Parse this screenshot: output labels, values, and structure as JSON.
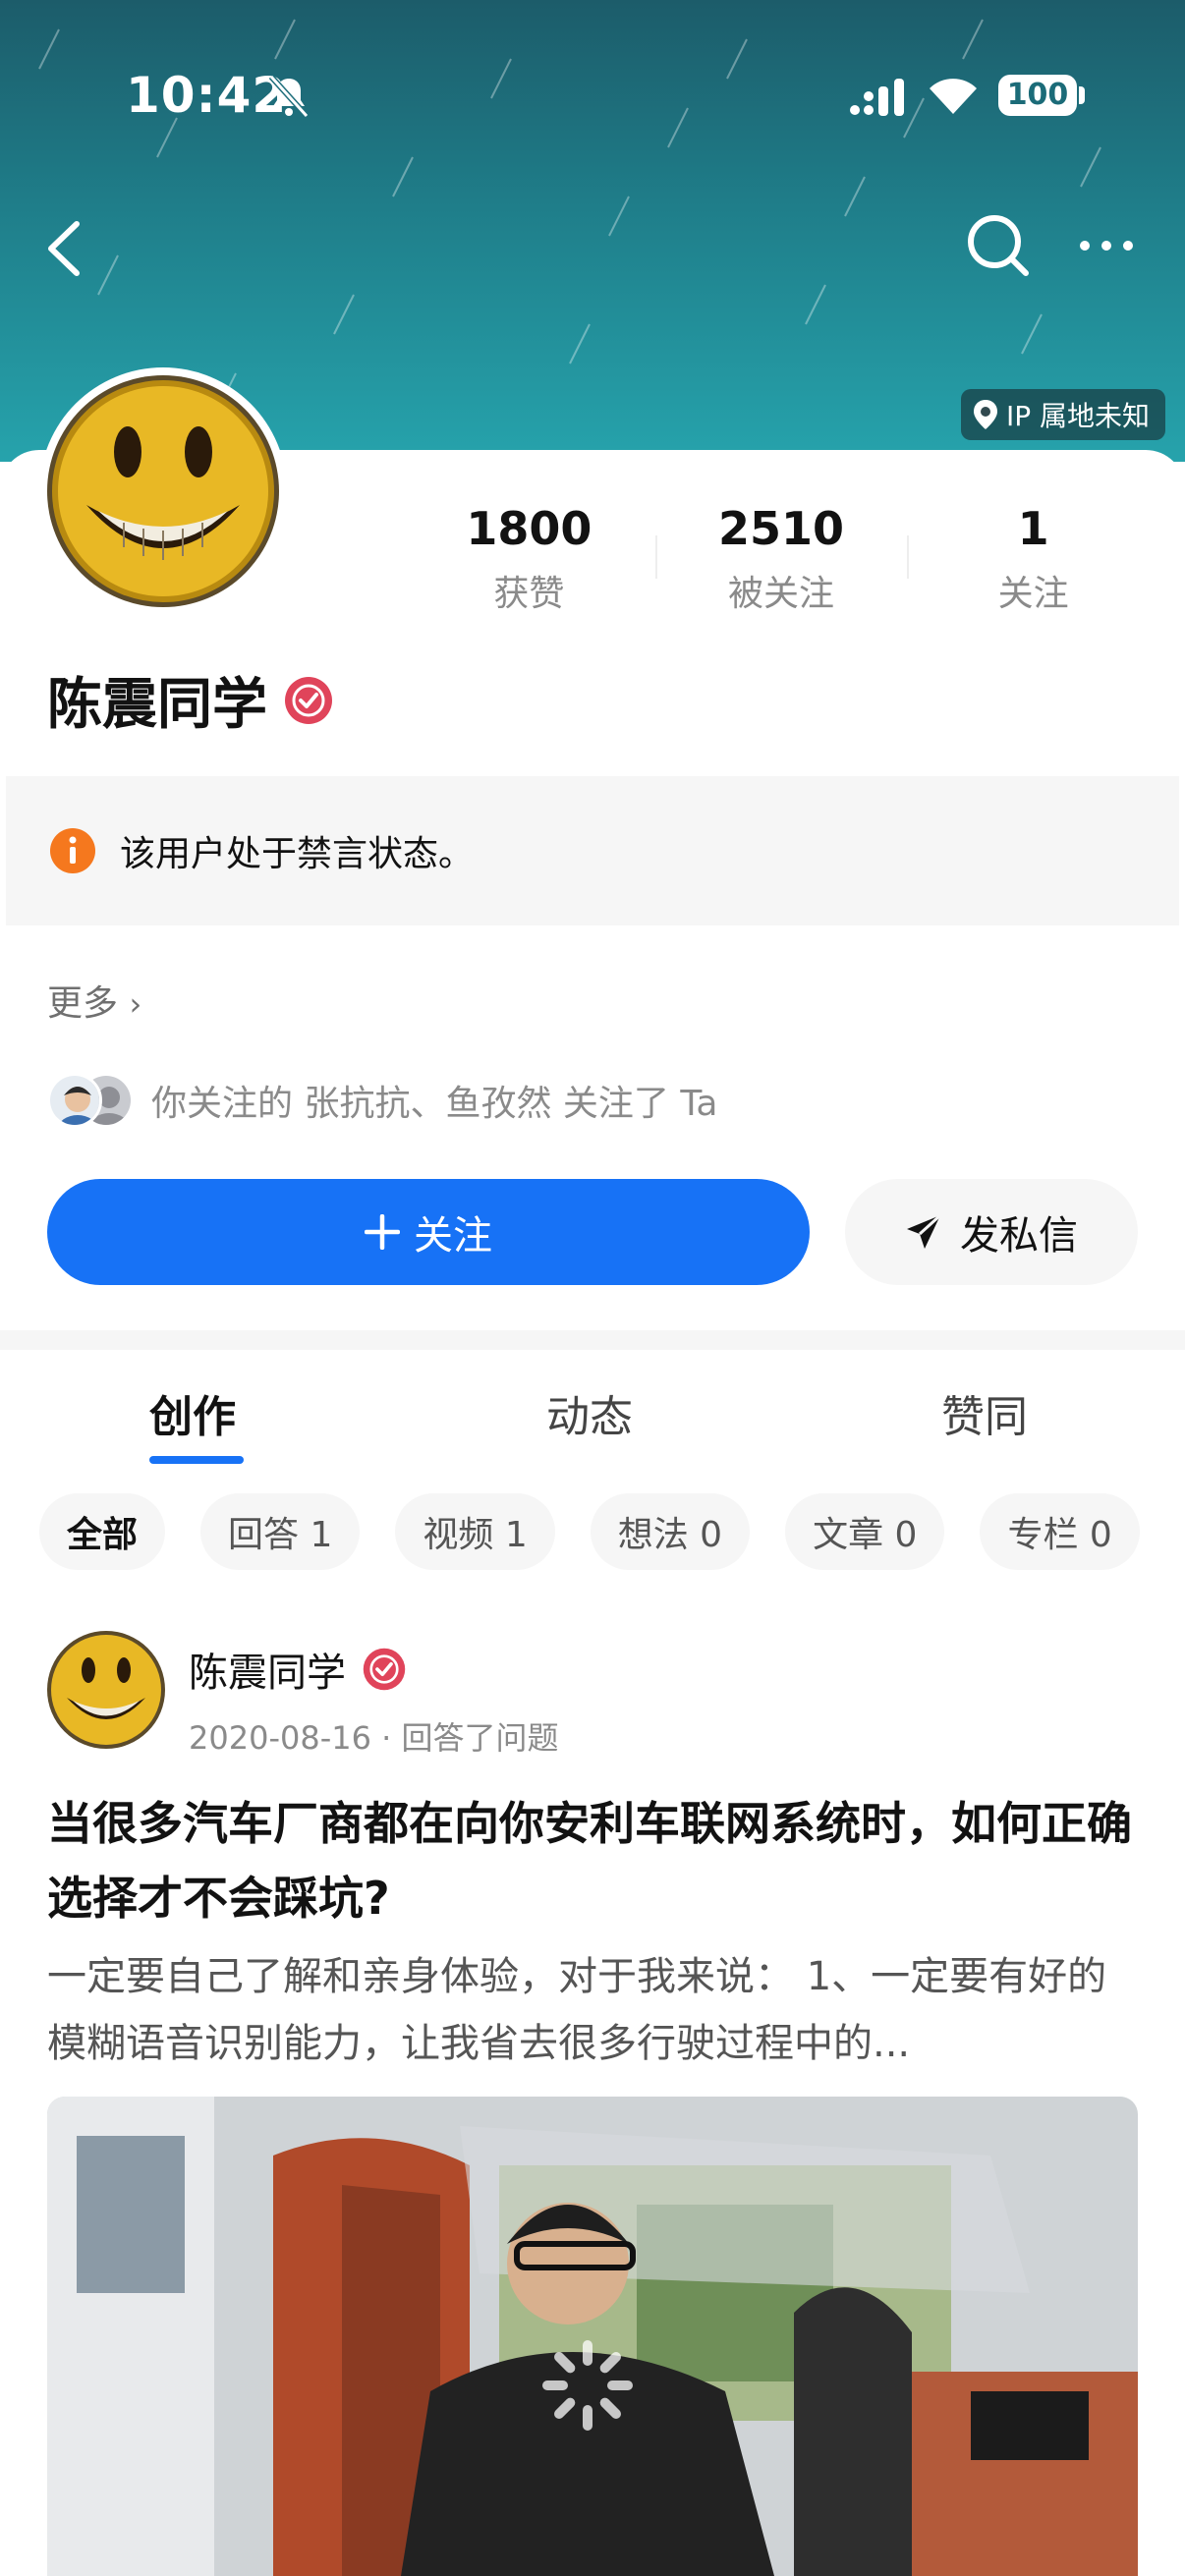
{
  "status_bar": {
    "time": "10:42",
    "battery": "100"
  },
  "header": {
    "ip_location": "IP 属地未知"
  },
  "profile": {
    "name": "陈震同学",
    "stats": [
      {
        "value": "1800",
        "label": "获赞"
      },
      {
        "value": "2510",
        "label": "被关注"
      },
      {
        "value": "1",
        "label": "关注"
      }
    ],
    "notice": "该用户处于禁言状态。",
    "more_label": "更多",
    "mutual_followers": "你关注的 张抗抗、鱼孜然 关注了 Ta",
    "follow_label": "关注",
    "message_label": "发私信"
  },
  "tabs": [
    "创作",
    "动态",
    "赞同"
  ],
  "filters": [
    "全部",
    "回答 1",
    "视频 1",
    "想法 0",
    "文章 0",
    "专栏 0"
  ],
  "feed": {
    "author": "陈震同学",
    "date": "2020-08-16",
    "action": "回答了问题",
    "separator": "·",
    "title": "当很多汽车厂商都在向你安利车联网系统时，如何正确选择才不会踩坑?",
    "excerpt": "一定要自己了解和亲身体验，对于我来说： 1、一定要有好的模糊语音识别能力，让我省去很多行驶过程中的..."
  },
  "colors": {
    "accent": "#1772f6",
    "banner": "#1f7e8a",
    "notice_icon": "#f5781e",
    "verified": "#e0445a"
  }
}
